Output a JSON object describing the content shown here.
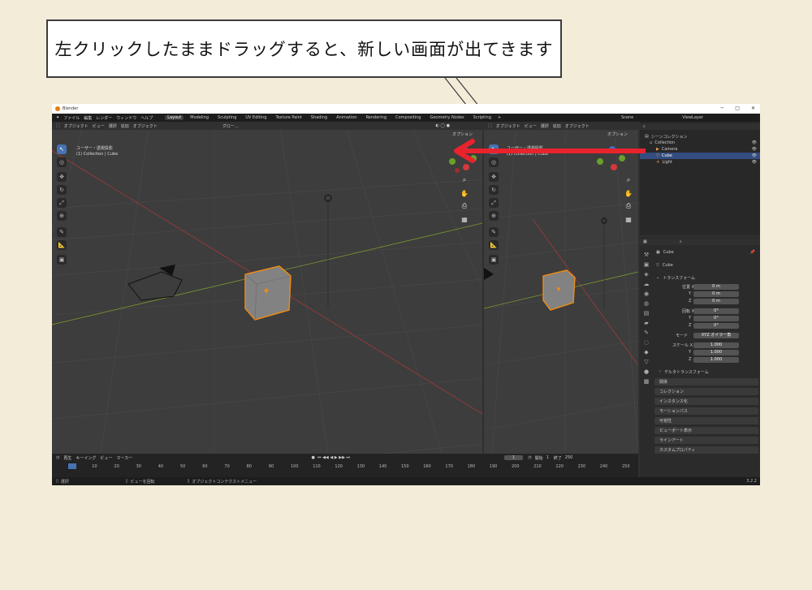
{
  "callout": {
    "text": "左クリックしたままドラッグすると、新しい画面が出てきます"
  },
  "app": {
    "title": "Blender",
    "menus": [
      "ファイル",
      "編集",
      "レンダー",
      "ウィンドウ",
      "ヘルプ"
    ],
    "workspaces": [
      "Layout",
      "Modeling",
      "Sculpting",
      "UV Editing",
      "Texture Paint",
      "Shading",
      "Animation",
      "Rendering",
      "Compositing",
      "Geometry Nodes",
      "Scripting"
    ],
    "active_workspace": "Layout",
    "scene": "Scene",
    "view_layer": "ViewLayer"
  },
  "viewport": {
    "mode": "オブジェクト",
    "menu": [
      "ビュー",
      "選択",
      "追加",
      "オブジェクト"
    ],
    "transform": "グロー...",
    "options": "オプション",
    "view_name": "ユーザー・透視投影",
    "collection_info": "(1) Collection | Cube"
  },
  "outliner": {
    "title": "シーンコレクション",
    "items": [
      {
        "label": "Collection"
      },
      {
        "label": "Camera"
      },
      {
        "label": "Cube"
      },
      {
        "label": "Light"
      }
    ]
  },
  "properties": {
    "object_name": "Cube",
    "mesh_name": "Cube",
    "transform_header": "トランスフォーム",
    "location": {
      "label": "位置 X",
      "x": "0 m",
      "y": "0 m",
      "z": "0 m"
    },
    "rotation": {
      "label": "回転 X",
      "x": "0°",
      "y": "0°",
      "z": "0°"
    },
    "mode_label": "モード",
    "mode_value": "XYZ オイラー角",
    "scale": {
      "label": "スケール X",
      "x": "1.000",
      "y": "1.000",
      "z": "1.000"
    },
    "axis_y": "Y",
    "axis_z": "Z",
    "delta": "デルタトランスフォーム",
    "panels": [
      "関係",
      "コレクション",
      "インスタンス化",
      "モーションパス",
      "可視性",
      "ビューポート表示",
      "ラインアート",
      "カスタムプロパティ"
    ]
  },
  "timeline": {
    "menu": [
      "再生",
      "キーイング",
      "ビュー",
      "マーカー"
    ],
    "current_frame": "1",
    "start_label": "開始",
    "start": "1",
    "end_label": "終了",
    "end": "250",
    "ticks": [
      "1",
      "10",
      "20",
      "30",
      "40",
      "50",
      "60",
      "70",
      "80",
      "90",
      "100",
      "110",
      "120",
      "130",
      "140",
      "150",
      "160",
      "170",
      "180",
      "190",
      "200",
      "210",
      "220",
      "230",
      "240",
      "250"
    ]
  },
  "status": {
    "select": "選択",
    "rotate": "ビューを回転",
    "context": "オブジェクトコンテクストメニュー",
    "version": "3.2.2"
  },
  "colors": {
    "arrow": "#e8232c",
    "selection": "#e88a1a",
    "accent": "#4772b3"
  }
}
